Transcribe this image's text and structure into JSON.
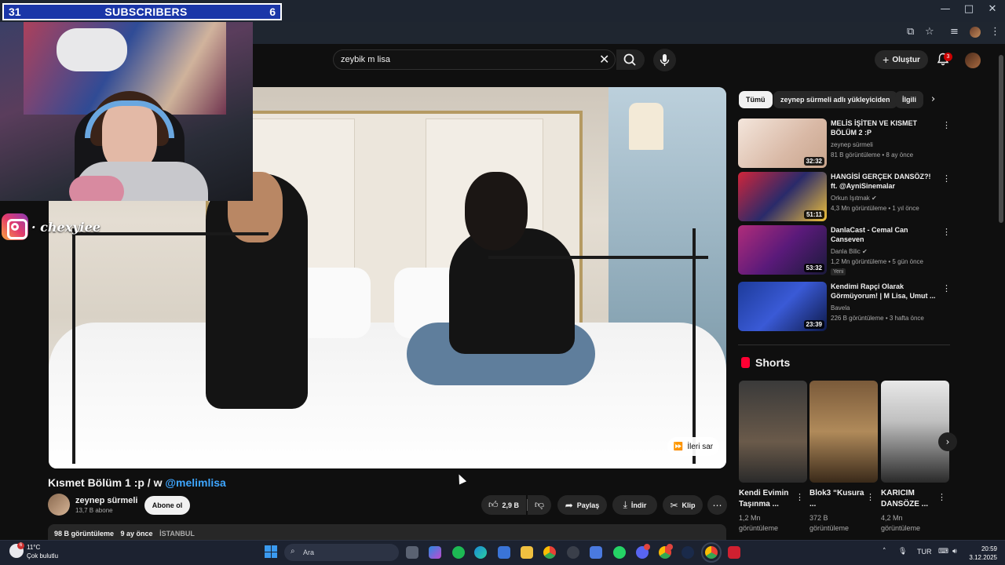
{
  "subscriber_bar": {
    "left_count": "31",
    "label": "SUBSCRIBERS",
    "right_count": "6"
  },
  "overlay": {
    "instagram_handle": "· chexyiee"
  },
  "search": {
    "query": "zeybik m lisa"
  },
  "header": {
    "create_label": "Oluştur",
    "notification_count": "3"
  },
  "video": {
    "title": "Kısmet Bölüm 1 :p / w",
    "mention": "@melimlisa",
    "skip_label": "İleri sar"
  },
  "channel": {
    "name": "zeynep sürmeli",
    "subscribers": "13,7 B abone",
    "subscribe_label": "Abone ol"
  },
  "actions": {
    "likes": "2,9 B",
    "share": "Paylaş",
    "download": "İndir",
    "clip": "Klip"
  },
  "description": {
    "views": "98 B görüntüleme",
    "age": "9 ay önce",
    "location": "İSTANBUL"
  },
  "chips": [
    "Tümü",
    "zeynep sürmeli adlı yükleyiciden",
    "İlgili"
  ],
  "recommendations": [
    {
      "title": "MELİS İŞİTEN VE KISMET BÖLÜM 2 :P",
      "channel": "zeynep sürmeli",
      "meta": "81 B görüntüleme • 8 ay önce",
      "duration": "32:32",
      "badge": ""
    },
    {
      "title": "HANGİSİ GERÇEK DANSÖZ?! ft. @AyniSinemalar",
      "channel": "Orkun Işıtmak ✔",
      "meta": "4,3 Mn görüntüleme • 1 yıl önce",
      "duration": "51:11",
      "badge": ""
    },
    {
      "title": "DanlaCast - Cemal Can Canseven",
      "channel": "Danla Bilic ✔",
      "meta": "1,2 Mn görüntüleme • 5 gün önce",
      "duration": "53:32",
      "badge": "Yeni"
    },
    {
      "title": "Kendimi Rapçi Olarak Görmüyorum! | M Lisa, Umut ...",
      "channel": "Bavela",
      "meta": "226 B görüntüleme • 3 hafta önce",
      "duration": "23:39",
      "badge": ""
    }
  ],
  "shorts": {
    "label": "Shorts",
    "items": [
      {
        "title": "Kendi Evimin Taşınma ...",
        "views": "1,2 Mn görüntüleme"
      },
      {
        "title": "Blok3 “Kusura ...",
        "views": "372 B görüntüleme"
      },
      {
        "title": "KARICIM DANSÖZE ...",
        "views": "4,2 Mn görüntüleme"
      }
    ]
  },
  "taskbar": {
    "weather_badge": "6",
    "temperature": "11°C",
    "condition": "Çok bulutlu",
    "search_placeholder": "Ara",
    "language": "TUR",
    "time": "20:59",
    "date": "3.12.2025"
  },
  "colors": {
    "youtube_red": "#ff0033",
    "link_blue": "#3ea6ff",
    "subscriber_bar_blue": "#1a36a8"
  }
}
